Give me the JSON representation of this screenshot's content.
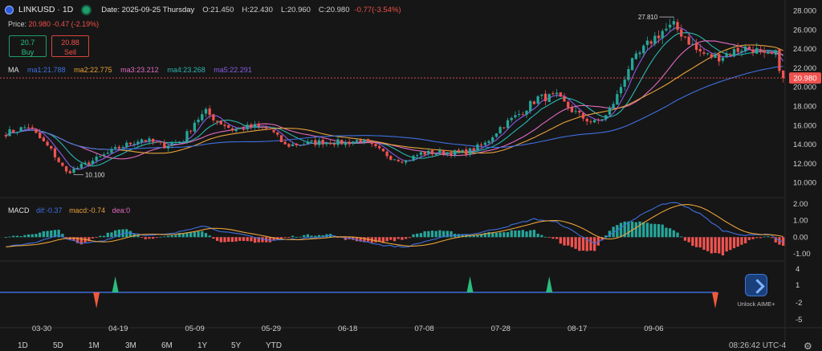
{
  "header": {
    "symbol": "LINKUSD · 1D",
    "date": "Date: 2025-09-25 Thursday",
    "open": "O:21.450",
    "high": "H:22.430",
    "low": "L:20.960",
    "close": "C:20.980",
    "change": "-0.77(-3.54%)",
    "price_label": "Price:",
    "price_value": "20.980 -0.47 (-2.19%)"
  },
  "trade": {
    "buy_price": "20.7",
    "buy_label": "Buy",
    "sell_price": "20.88",
    "sell_label": "Sell"
  },
  "ma_legend": {
    "title": "MA",
    "ma1": "ma1:21.788",
    "ma2": "ma2:22.775",
    "ma3": "ma3:23.212",
    "ma4": "ma4:23.268",
    "ma5": "ma5:22.291"
  },
  "macd_legend": {
    "title": "MACD",
    "dif": "dif:-0.37",
    "macd": "macd:-0.74",
    "dea": "dea:0"
  },
  "colors": {
    "background": "#161616",
    "up": "#26a69a",
    "down": "#ef5350",
    "ma1": "#3f6fe0",
    "ma2": "#e8a23a",
    "ma3": "#e06cc0",
    "ma4": "#2bb5b0",
    "ma5": "#8a5ce6",
    "signal_line": "#3a6fd8"
  },
  "aime": {
    "label": "Unlock AIME+"
  },
  "timeframes": [
    "1D",
    "5D",
    "1M",
    "3M",
    "6M",
    "1Y",
    "5Y",
    "YTD"
  ],
  "clock": "08:26:42 UTC-4",
  "chart_data": {
    "type": "candlestick",
    "price_axis": {
      "ticks": [
        "28.000",
        "26.000",
        "24.000",
        "22.000",
        "20.000",
        "18.000",
        "16.000",
        "14.000",
        "12.000",
        "10.000"
      ],
      "range": [
        9.3,
        28.3
      ]
    },
    "last_price": "20.980",
    "high_marker": "27.810",
    "low_marker": "10.100",
    "macd_axis": {
      "ticks": [
        "2.00",
        "1.00",
        "0.00",
        "-1.00"
      ],
      "range": [
        -1.3,
        2.2
      ]
    },
    "signal_axis": {
      "ticks": [
        "4",
        "1",
        "-2",
        "-5"
      ]
    },
    "x_labels": [
      "03-30",
      "04-19",
      "05-09",
      "05-29",
      "06-18",
      "07-08",
      "07-28",
      "08-17",
      "09-06"
    ],
    "anchors": [
      [
        0,
        15.2
      ],
      [
        6,
        15.9
      ],
      [
        12,
        13.4
      ],
      [
        16,
        11.1
      ],
      [
        18,
        11.4
      ],
      [
        24,
        12.5
      ],
      [
        30,
        13.7
      ],
      [
        36,
        14.6
      ],
      [
        42,
        13.9
      ],
      [
        47,
        14.5
      ],
      [
        50,
        16.4
      ],
      [
        53,
        17.4
      ],
      [
        56,
        16.5
      ],
      [
        60,
        15.6
      ],
      [
        66,
        15.9
      ],
      [
        70,
        15.6
      ],
      [
        74,
        13.9
      ],
      [
        79,
        14.1
      ],
      [
        84,
        14.3
      ],
      [
        90,
        14.2
      ],
      [
        94,
        14.5
      ],
      [
        98,
        13.6
      ],
      [
        102,
        12.7
      ],
      [
        106,
        12.3
      ],
      [
        110,
        13.1
      ],
      [
        116,
        13.2
      ],
      [
        122,
        13.2
      ],
      [
        127,
        14.1
      ],
      [
        131,
        15.8
      ],
      [
        136,
        17.2
      ],
      [
        141,
        18.9
      ],
      [
        146,
        19.0
      ],
      [
        150,
        17.6
      ],
      [
        153,
        16.8
      ],
      [
        156,
        16.3
      ],
      [
        159,
        17.0
      ],
      [
        162,
        19.1
      ],
      [
        165,
        22.1
      ],
      [
        168,
        23.5
      ],
      [
        171,
        24.9
      ],
      [
        174,
        25.9
      ],
      [
        177,
        26.4
      ],
      [
        180,
        25.3
      ],
      [
        183,
        23.9
      ],
      [
        186,
        23.3
      ],
      [
        189,
        23.2
      ],
      [
        192,
        23.6
      ],
      [
        195,
        24.1
      ],
      [
        198,
        24.1
      ],
      [
        201,
        23.2
      ],
      [
        204,
        23.4
      ],
      [
        206,
        20.98
      ]
    ],
    "macd_anchors": [
      [
        0,
        -0.6
      ],
      [
        8,
        -0.3
      ],
      [
        14,
        0.1
      ],
      [
        20,
        -0.4
      ],
      [
        26,
        -0.2
      ],
      [
        32,
        0.3
      ],
      [
        38,
        0.1
      ],
      [
        44,
        0.2
      ],
      [
        52,
        0.7
      ],
      [
        58,
        0.3
      ],
      [
        64,
        0.1
      ],
      [
        70,
        -0.2
      ],
      [
        78,
        -0.1
      ],
      [
        86,
        0.1
      ],
      [
        94,
        -0.2
      ],
      [
        100,
        -0.5
      ],
      [
        106,
        -0.6
      ],
      [
        112,
        -0.2
      ],
      [
        118,
        0.1
      ],
      [
        124,
        0.2
      ],
      [
        132,
        0.6
      ],
      [
        140,
        1.1
      ],
      [
        146,
        0.9
      ],
      [
        150,
        0.4
      ],
      [
        156,
        -0.4
      ],
      [
        162,
        0.4
      ],
      [
        168,
        1.3
      ],
      [
        174,
        2.0
      ],
      [
        178,
        2.1
      ],
      [
        184,
        1.4
      ],
      [
        190,
        0.4
      ],
      [
        196,
        0.1
      ],
      [
        202,
        0.2
      ],
      [
        206,
        -0.3
      ]
    ],
    "signals": [
      {
        "index": 24,
        "type": "sell"
      },
      {
        "index": 29,
        "type": "buy"
      },
      {
        "index": 123,
        "type": "buy"
      },
      {
        "index": 144,
        "type": "buy"
      },
      {
        "index": 188,
        "type": "sell"
      }
    ]
  }
}
